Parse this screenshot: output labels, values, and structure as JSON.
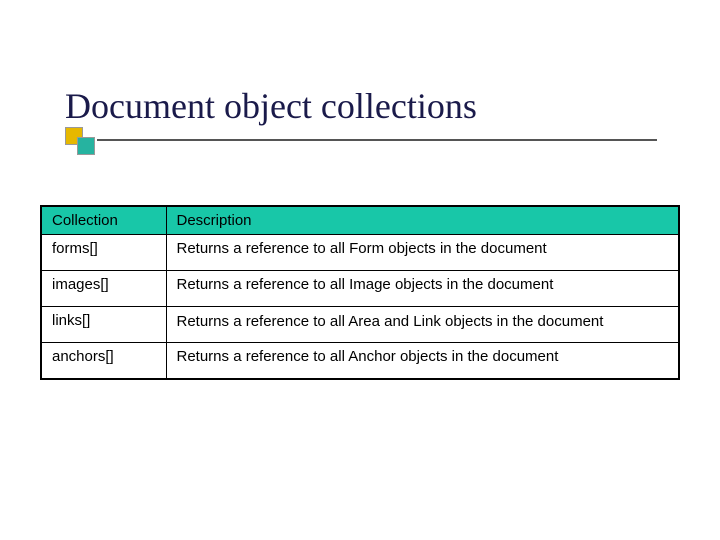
{
  "title": "Document object collections",
  "table": {
    "headers": {
      "collection": "Collection",
      "description": "Description"
    },
    "rows": [
      {
        "collection": "forms[]",
        "description": "Returns a reference to all Form objects in the document"
      },
      {
        "collection": "images[]",
        "description": "Returns a reference to all Image objects in the document"
      },
      {
        "collection": "links[]",
        "description": "Returns a reference to all Area and Link objects in the document"
      },
      {
        "collection": "anchors[]",
        "description": "Returns a reference to all Anchor objects in the document"
      }
    ]
  }
}
